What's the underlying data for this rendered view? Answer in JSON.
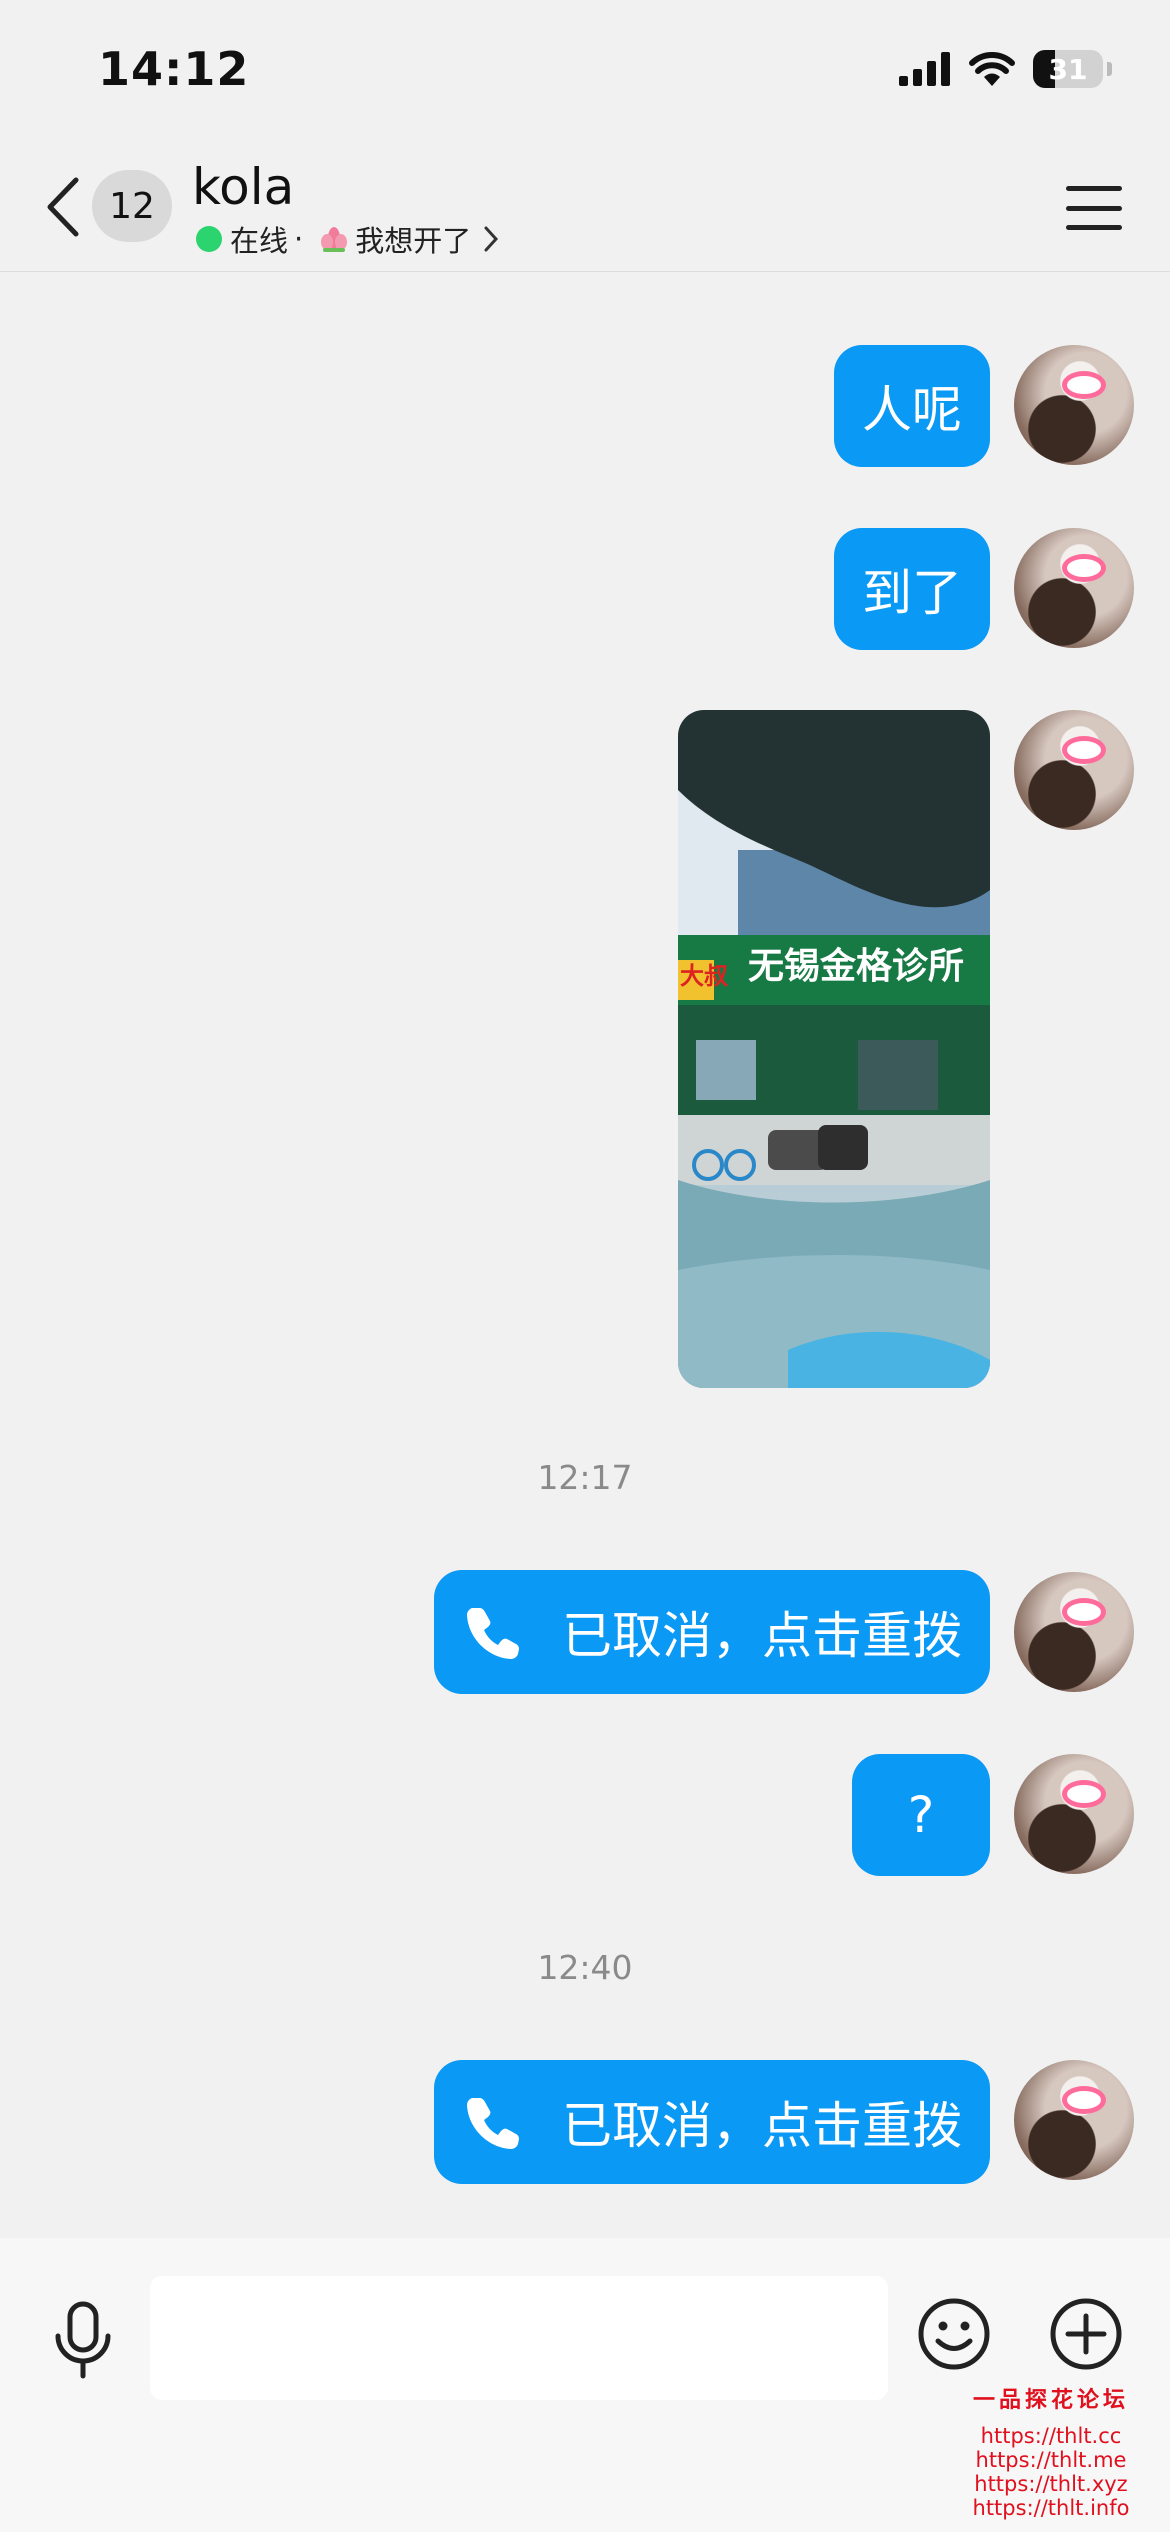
{
  "status_bar": {
    "time": "14:12",
    "battery_level": "31",
    "icons": [
      "cellular-signal-icon",
      "wifi-icon",
      "battery-icon"
    ]
  },
  "header": {
    "unread_count": "12",
    "contact_name": "kola",
    "online_status": "在线",
    "separator": "·",
    "mood_text": "我想开了",
    "icons": [
      "back-chevron-icon",
      "lotus-icon",
      "chevron-right-icon",
      "menu-icon"
    ]
  },
  "messages": [
    {
      "type": "text",
      "text": "人呢"
    },
    {
      "type": "text",
      "text": "到了"
    },
    {
      "type": "image",
      "sign_text": "无锡金格诊所",
      "sign_side_text": "大叔"
    },
    {
      "type": "timestamp",
      "text": "12:17"
    },
    {
      "type": "call",
      "text": "已取消，点击重拨"
    },
    {
      "type": "text",
      "text": "?"
    },
    {
      "type": "timestamp",
      "text": "12:40"
    },
    {
      "type": "call",
      "text": "已取消，点击重拨"
    }
  ],
  "input_bar": {
    "placeholder": "",
    "icons": [
      "microphone-icon",
      "emoji-icon",
      "plus-icon"
    ]
  },
  "watermark": {
    "title": "一品探花论坛",
    "links": [
      "https://thlt.cc",
      "https://thlt.me",
      "https://thlt.xyz",
      "https://thlt.info"
    ]
  },
  "colors": {
    "bubble": "#0a99f5",
    "background": "#f1f1f1",
    "online": "#2bd46e",
    "watermark": "#e0101e"
  }
}
